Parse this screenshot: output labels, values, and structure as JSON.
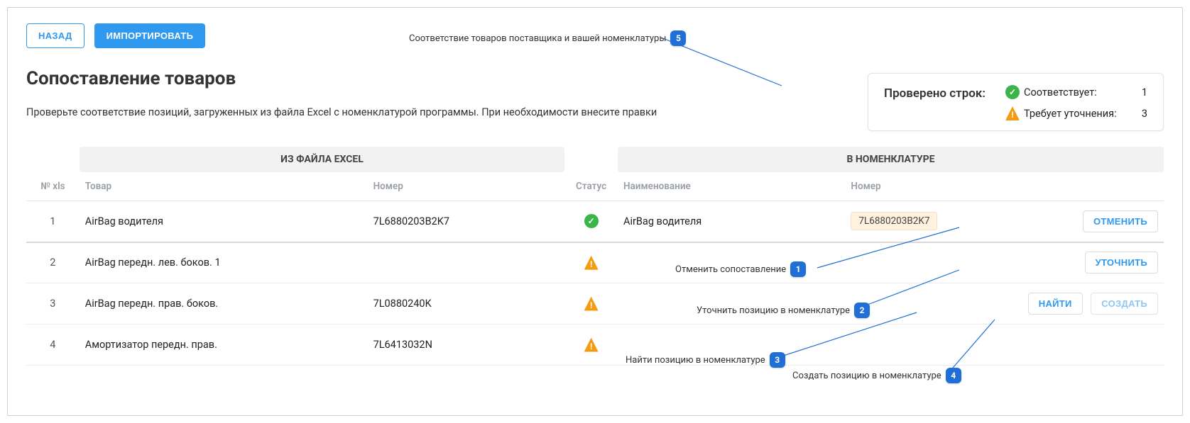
{
  "top_buttons": {
    "back": "НАЗАД",
    "import": "ИМПОРТИРОВАТЬ"
  },
  "title": "Сопоставление товаров",
  "subtitle": "Проверьте соответствие позиций, загруженных из файла Excel с номенклатурой программы. При необходимости внесите правки",
  "status_panel": {
    "label": "Проверено строк:",
    "ok_label": "Соответствует:",
    "ok_count": "1",
    "warn_label": "Требует уточнения:",
    "warn_count": "3"
  },
  "table": {
    "group_excel": "ИЗ ФАЙЛА EXCEL",
    "group_nomen": "В НОМЕНКЛАТУРЕ",
    "headers": {
      "num": "№ xls",
      "product": "Товар",
      "number": "Номер",
      "status": "Статус",
      "name": "Наименование",
      "nomen_number": "Номер"
    },
    "rows": [
      {
        "num": "1",
        "product": "AirBag водителя",
        "number": "7L6880203B2K7",
        "status": "ok",
        "nomen_name": "AirBag водителя",
        "nomen_number": "7L6880203B2K7",
        "actions": [
          "ОТМЕНИТЬ"
        ]
      },
      {
        "num": "2",
        "product": "AirBag передн. лев. боков. 1",
        "number": "",
        "status": "warn",
        "nomen_name": "",
        "nomen_number": "",
        "actions": [
          "УТОЧНИТЬ"
        ]
      },
      {
        "num": "3",
        "product": "AirBag передн. прав. боков.",
        "number": "7L0880240K",
        "status": "warn",
        "nomen_name": "",
        "nomen_number": "",
        "actions": [
          "НАЙТИ",
          "СОЗДАТЬ"
        ]
      },
      {
        "num": "4",
        "product": "Амортизатор передн. прав.",
        "number": "7L6413032N",
        "status": "warn",
        "nomen_name": "",
        "nomen_number": "",
        "actions": []
      }
    ]
  },
  "annotations": {
    "a1": "Отменить сопоставление",
    "a2": "Уточнить позицию в номенклатуре",
    "a3": "Найти позицию в номенклатуре",
    "a4": "Создать позицию в номенклатуре",
    "a5": "Соответствие товаров поставщика и вашей номенклатуры",
    "n1": "1",
    "n2": "2",
    "n3": "3",
    "n4": "4",
    "n5": "5"
  },
  "icons": {
    "check": "✓",
    "excl": "!"
  }
}
